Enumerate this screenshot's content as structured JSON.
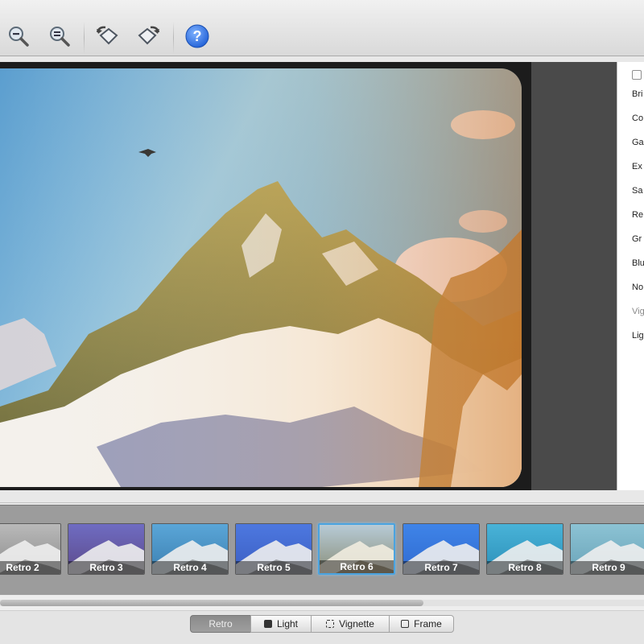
{
  "toolbar": {
    "buttons": [
      {
        "name": "zoom-in-icon"
      },
      {
        "name": "zoom-fit-icon"
      },
      {
        "name": "rotate-left-icon"
      },
      {
        "name": "rotate-right-icon"
      },
      {
        "name": "help-icon",
        "glyph": "?"
      }
    ]
  },
  "adjustments": {
    "labels": [
      "Bri",
      "Co",
      "Ga",
      "Ex",
      "Sa",
      "Re",
      "Gr",
      "Blu",
      "No",
      "Vig",
      "Lig"
    ]
  },
  "filmstrip": {
    "thumbs": [
      {
        "label": "Retro 2",
        "tint": "#8d8d8d",
        "sky": "#b9b9b9"
      },
      {
        "label": "Retro 3",
        "tint": "#5c4a8a",
        "sky": "#6f6cc2"
      },
      {
        "label": "Retro 4",
        "tint": "#3c7fb0",
        "sky": "#5aa6d8"
      },
      {
        "label": "Retro 5",
        "tint": "#3b5ec2",
        "sky": "#4d78e0"
      },
      {
        "label": "Retro 6",
        "tint": "#8a8f7a",
        "sky": "#b7cbd6",
        "selected": true
      },
      {
        "label": "Retro 7",
        "tint": "#2f6ad0",
        "sky": "#3f84e8"
      },
      {
        "label": "Retro 8",
        "tint": "#2b8fb8",
        "sky": "#49b3d8"
      },
      {
        "label": "Retro 9",
        "tint": "#6aa3b8",
        "sky": "#8cc3d4"
      }
    ]
  },
  "tabs": [
    {
      "label": "Retro",
      "active": true
    },
    {
      "label": "Light",
      "active": false
    },
    {
      "label": "Vignette",
      "active": false
    },
    {
      "label": "Frame",
      "active": false
    }
  ]
}
